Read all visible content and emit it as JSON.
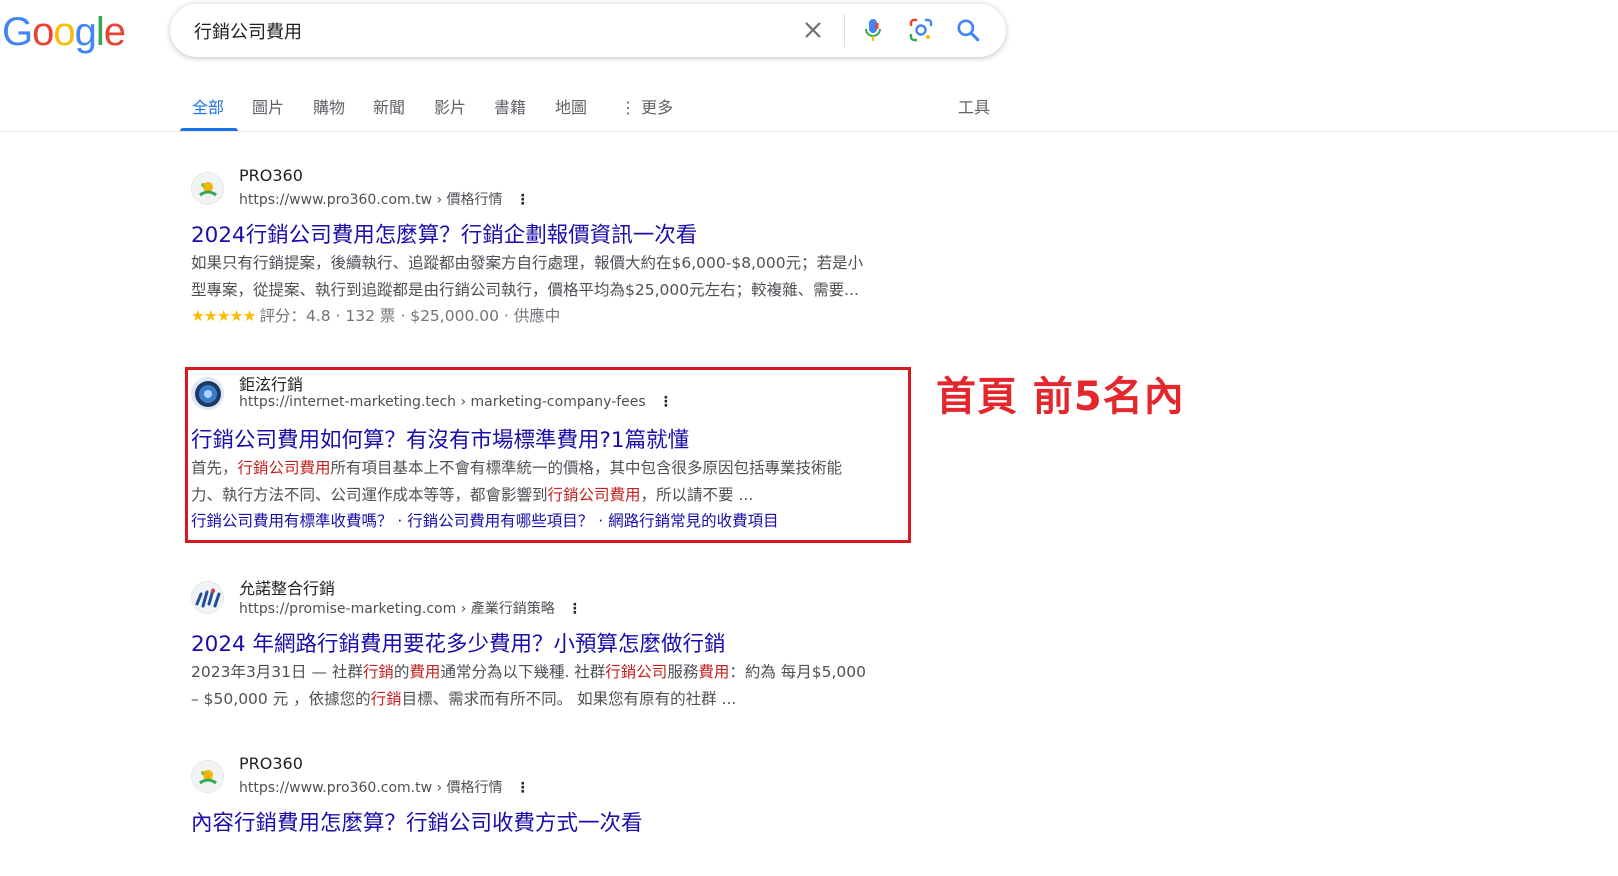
{
  "logo": {
    "letters": [
      "G",
      "o",
      "o",
      "g",
      "l",
      "e"
    ],
    "colors": [
      "#4285F4",
      "#EA4335",
      "#FBBC05",
      "#4285F4",
      "#34A853",
      "#EA4335"
    ]
  },
  "search": {
    "query": "行銷公司費用"
  },
  "tabs": [
    {
      "label": "全部",
      "active": true
    },
    {
      "label": "圖片"
    },
    {
      "label": "購物"
    },
    {
      "label": "新聞"
    },
    {
      "label": "影片"
    },
    {
      "label": "書籍"
    },
    {
      "label": "地圖"
    },
    {
      "label": "⋮ 更多"
    }
  ],
  "tools_label": "工具",
  "results": [
    {
      "site": "PRO360",
      "url": "https://www.pro360.com.tw › 價格行情",
      "title": "2024行銷公司費用怎麼算？行銷企劃報價資訊一次看",
      "snippet_line1": "如果只有行銷提案，後續執行、追蹤都由發案方自行處理，報價大約在$6,000-$8,000元；若是小",
      "snippet_line2": "型專案，從提案、執行到追蹤都是由行銷公司執行，價格平均為$25,000元左右；較複雜、需要...",
      "stars": "★★★★★",
      "rating_text": "評分：4.8 · 132 票 · $25,000.00 · 供應中"
    },
    {
      "site": "鉅泫行銷",
      "url": "https://internet-marketing.tech › marketing-company-fees",
      "title": "行銷公司費用如何算？有沒有市場標準費用?1篇就懂",
      "s1a": "首先，",
      "s1b": "行銷公司費用",
      "s1c": "所有項目基本上不會有標準統一的價格，其中包含很多原因包括專業技術能",
      "s2a": "力、執行方法不同、公司運作成本等等，都會影響到",
      "s2b": "行銷公司費用",
      "s2c": "，所以請不要 ...",
      "sitelinks": "行銷公司費用有標準收費嗎？ · 行銷公司費用有哪些項目？ · 網路行銷常見的收費項目"
    },
    {
      "site": "允諾整合行銷",
      "url": "https://promise-marketing.com › 產業行銷策略",
      "title": "2024 年網路行銷費用要花多少費用？小預算怎麼做行銷",
      "s1a": "2023年3月31日 — 社群",
      "s1b": "行銷",
      "s1c": "的",
      "s1d": "費用",
      "s1e": "通常分為以下幾種. 社群",
      "s1f": "行銷公司",
      "s1g": "服務",
      "s1h": "費用",
      "s1i": "：約為 每月$5,000",
      "s2a": "– $50,000 元 ，依據您的",
      "s2b": "行銷",
      "s2c": "目標、需求而有所不同。 如果您有原有的社群 ..."
    },
    {
      "site": "PRO360",
      "url": "https://www.pro360.com.tw › 價格行情",
      "title": "內容行銷費用怎麼算？行銷公司收費方式一次看"
    }
  ],
  "annotation": "首頁 前5名內",
  "colors": {
    "link": "#1a0dab",
    "highlight": "#c5221f",
    "annotation": "#e4262d",
    "box": "#d71920",
    "accent": "#1a73e8"
  }
}
